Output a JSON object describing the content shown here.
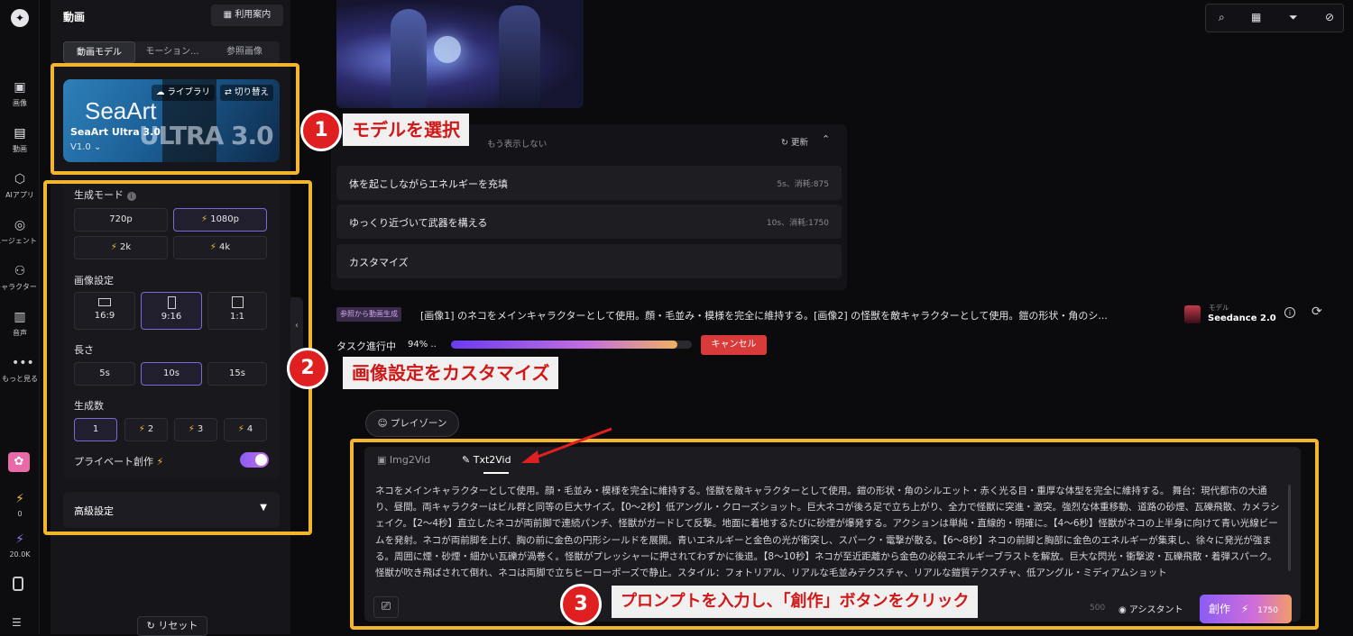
{
  "rail": {
    "items": [
      {
        "label": "画像",
        "icon": "image-icon"
      },
      {
        "label": "動画",
        "icon": "video-icon"
      },
      {
        "label": "AIアプリ",
        "icon": "ai-app-icon"
      },
      {
        "label": "エージェント",
        "icon": "agent-icon"
      },
      {
        "label": "キャラクター",
        "icon": "character-icon"
      },
      {
        "label": "音声",
        "icon": "audio-icon"
      },
      {
        "label": "もっと見る",
        "icon": "more-icon"
      }
    ],
    "credits_a": "0",
    "credits_b": "20.0K"
  },
  "panel": {
    "title": "動画",
    "guide_button": "利用案内",
    "tabs": [
      "動画モデル",
      "モーション...",
      "参照画像"
    ],
    "model_card": {
      "library": "ライブラリ",
      "switch": "切り替え",
      "brand": "SeaArt",
      "big_text": "ULTRA 3.0",
      "name": "SeaArt Ultra 3.0",
      "version": "V1.0"
    },
    "mode_label": "生成モード",
    "modes": [
      "720p",
      "1080p",
      "2k",
      "4k"
    ],
    "image_setting_label": "画像設定",
    "ratios": [
      "16:9",
      "9:16",
      "1:1"
    ],
    "length_label": "長さ",
    "lengths": [
      "5s",
      "10s",
      "15s"
    ],
    "count_label": "生成数",
    "counts": [
      "1",
      "2",
      "3",
      "4"
    ],
    "private_label": "プライベート創作",
    "advanced_label": "高級設定",
    "reset_button": "リセット"
  },
  "main": {
    "suggest_header": "もう表示しない",
    "refresh": "更新",
    "suggestions": [
      {
        "text": "体を起こしながらエネルギーを充填",
        "meta": "5s、消耗:875"
      },
      {
        "text": "ゆっくり近づいて武器を構える",
        "meta": "10s、消耗:1750"
      },
      {
        "text": "カスタマイズ",
        "meta": ""
      }
    ],
    "task_tag": "参照から動画生成",
    "task_desc": "[画像1] のネコをメインキャラクターとして使用。顔・毛並み・模様を完全に維持する。[画像2] の怪獣を敵キャラクターとして使用。鎧の形状・角のシ...",
    "model_label": "モデル",
    "model_name": "Seedance 2.0",
    "progress_label": "タスク進行中",
    "progress_pct": "94% ..",
    "progress_value": 0.94,
    "cancel": "キャンセル",
    "playzone": "プレイゾーン",
    "prompt_tabs": [
      "Img2Vid",
      "Txt2Vid"
    ],
    "prompt_text": "ネコをメインキャラクターとして使用。顔・毛並み・模様を完全に維持する。怪獣を敵キャラクターとして使用。鎧の形状・角のシルエット・赤く光る目・重厚な体型を完全に維持する。 舞台：現代都市の大通り、昼間。両キャラクターはビル群と同等の巨大サイズ。【0〜2秒】低アングル・クローズショット。巨大ネコが後ろ足で立ち上がり、全力で怪獣に突進・激突。強烈な体重移動、道路の砂煙、瓦礫飛散、カメラシェイク。【2〜4秒】直立したネコが両前脚で連続パンチ、怪獣がガードして反撃。地面に着地するたびに砂煙が爆発する。アクションは単純・直線的・明確に。【4〜6秒】怪獣がネコの上半身に向けて青い光線ビームを発射。ネコが両前脚を上げ、胸の前に金色の円形シールドを展開。青いエネルギーと金色の光が衝突し、スパーク・電撃が散る。【6〜8秒】ネコの前脚と胸部に金色のエネルギーが集束し、徐々に発光が強まる。周囲に煙・砂煙・細かい瓦礫が渦巻く。怪獣がプレッシャーに押されてわずかに後退。【8〜10秒】ネコが至近距離から金色の必殺エネルギーブラストを解放。巨大な閃光・衝撃波・瓦礫飛散・着弾スパーク。怪獣が吹き飛ばされて倒れ、ネコは両脚で立ちヒーローポーズで静止。スタイル：フォトリアル、リアルな毛並みテクスチャ、リアルな鎧質テクスチャ、低アングル・ミディアムショット",
    "char_count": "500",
    "assistant": "アシスタント",
    "create": "創作",
    "create_cost": "1750"
  },
  "callouts": [
    {
      "num": "1",
      "text": "モデルを選択"
    },
    {
      "num": "2",
      "text": "画像設定をカスタマイズ"
    },
    {
      "num": "3",
      "text": "プロンプトを入力し、「創作」ボタンをクリック"
    }
  ],
  "colors": {
    "accent": "#7a6ad8",
    "highlight": "#f3b52c",
    "callout": "#e02020"
  }
}
